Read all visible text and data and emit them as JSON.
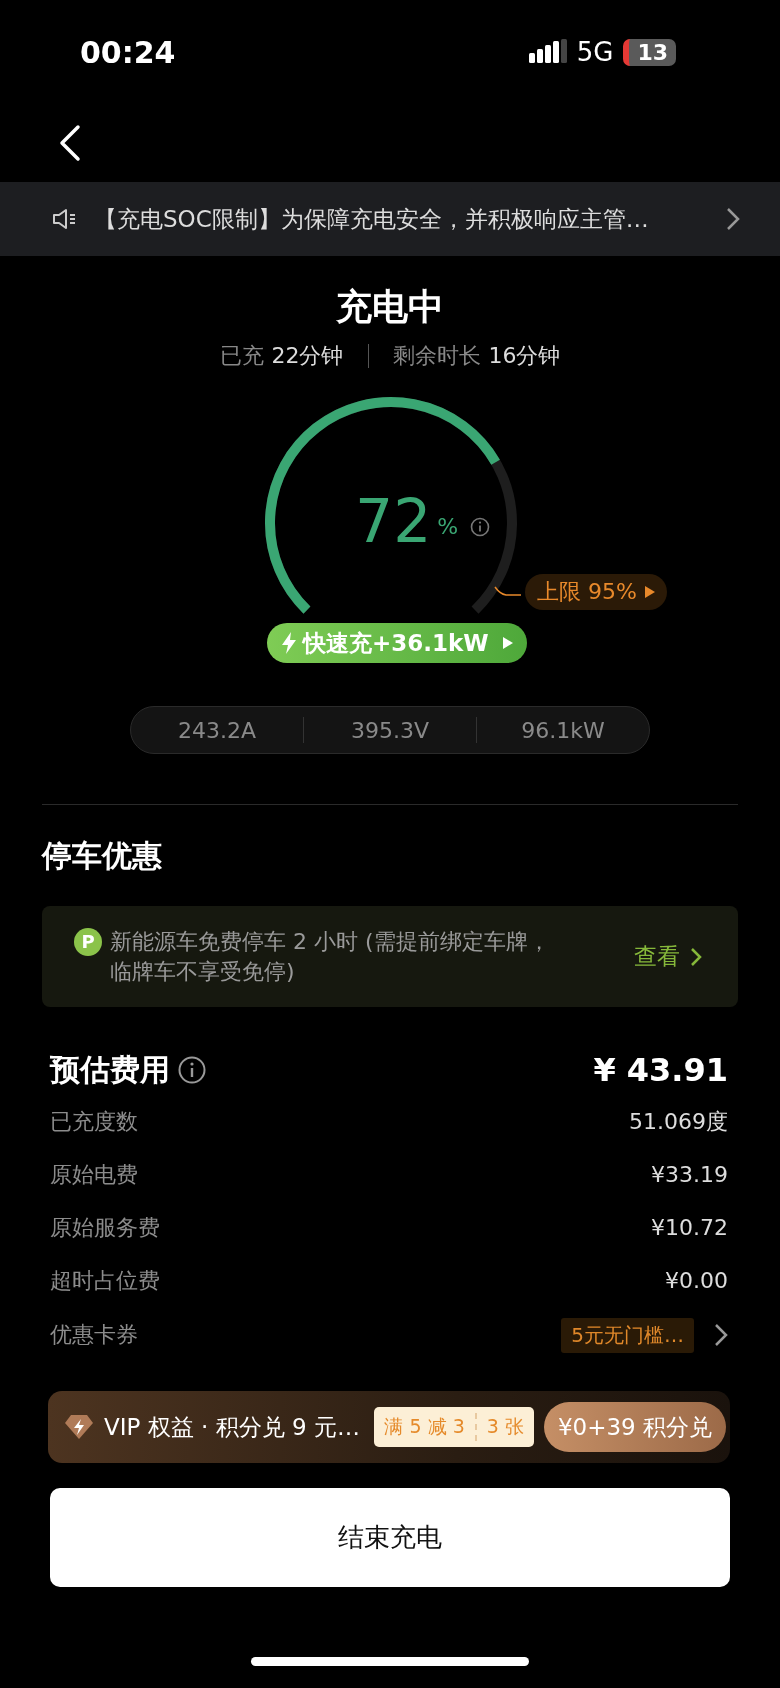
{
  "status_bar": {
    "time": "00:24",
    "network": "5G",
    "battery": "13"
  },
  "notice": {
    "text": "【充电SOC限制】为保障充电安全，并积极响应主管…"
  },
  "header": {
    "title": "充电中",
    "charged_label": "已充",
    "charged_value": "22分钟",
    "remaining_label": "剩余时长",
    "remaining_value": "16分钟"
  },
  "gauge": {
    "percent": "72",
    "unit": "%",
    "limit": "上限 95%",
    "fast_charge": "快速充+36.1kW"
  },
  "readings": [
    "243.2A",
    "395.3V",
    "96.1kW"
  ],
  "parking": {
    "heading": "停车优惠",
    "badge": "P",
    "text": "新能源车免费停车 2 小时 (需提前绑定车牌，临牌车不享受免停)",
    "action": "查看"
  },
  "fee": {
    "title": "预估费用",
    "total": "¥ 43.91",
    "rows": [
      {
        "label": "已充度数",
        "value": "51.069度"
      },
      {
        "label": "原始电费",
        "value": "¥33.19"
      },
      {
        "label": "原始服务费",
        "value": "¥10.72"
      },
      {
        "label": "超时占位费",
        "value": "¥0.00"
      }
    ],
    "coupon": {
      "label": "优惠卡券",
      "value": "5元无门槛…"
    }
  },
  "vip": {
    "text": "VIP 权益 · 积分兑 9 元…",
    "ticket_left": "满 5 减 3",
    "ticket_right": "3 张",
    "button": "¥0+39 积分兑"
  },
  "end_button": "结束充电"
}
